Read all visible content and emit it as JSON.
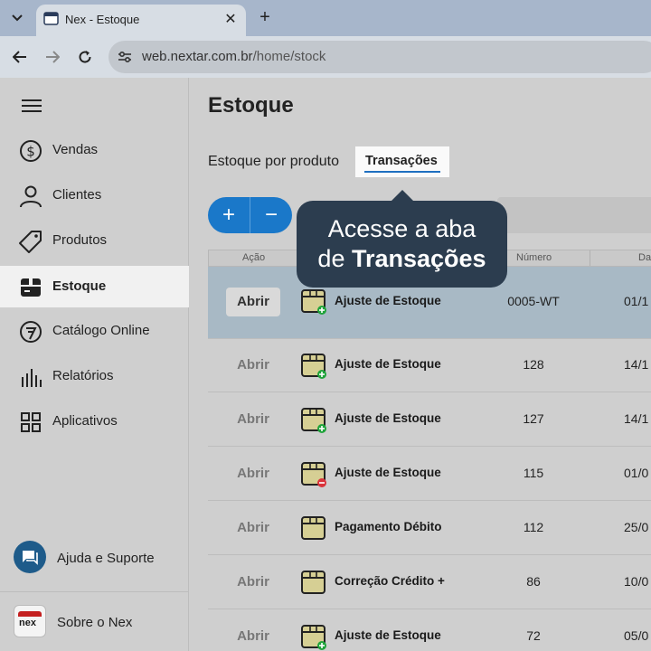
{
  "browser": {
    "tab_title": "Nex - Estoque",
    "url_host": "web.nextar.com.br",
    "url_path": "/home/stock"
  },
  "sidebar": {
    "items": [
      {
        "label": "Vendas",
        "icon": "dollar-circle-icon"
      },
      {
        "label": "Clientes",
        "icon": "user-icon"
      },
      {
        "label": "Produtos",
        "icon": "tag-icon"
      },
      {
        "label": "Estoque",
        "icon": "box-icon",
        "active": true
      },
      {
        "label": "Catálogo Online",
        "icon": "catalog-icon"
      },
      {
        "label": "Relatórios",
        "icon": "bar-chart-icon"
      },
      {
        "label": "Aplicativos",
        "icon": "apps-grid-icon"
      }
    ],
    "help_label": "Ajuda e Suporte",
    "about_label": "Sobre o Nex",
    "logo_text": "nex"
  },
  "main": {
    "title": "Estoque",
    "tabs": [
      {
        "label": "Estoque por produto"
      },
      {
        "label": "Transações",
        "active": true
      }
    ],
    "add_button": "+",
    "remove_button": "−",
    "callout": {
      "line1": "Acesse a aba",
      "line2_prefix": "de ",
      "line2_bold": "Transações"
    },
    "columns": [
      "Ação",
      "Número",
      "Dat"
    ],
    "rows": [
      {
        "action": "Abrir",
        "type": "Ajuste de Estoque",
        "badge": "plus",
        "number": "0005-WT",
        "date": "01/1"
      },
      {
        "action": "Abrir",
        "type": "Ajuste de Estoque",
        "badge": "plus",
        "number": "128",
        "date": "14/1"
      },
      {
        "action": "Abrir",
        "type": "Ajuste de Estoque",
        "badge": "plus",
        "number": "127",
        "date": "14/1"
      },
      {
        "action": "Abrir",
        "type": "Ajuste de Estoque",
        "badge": "minus",
        "number": "115",
        "date": "01/0"
      },
      {
        "action": "Abrir",
        "type": "Pagamento Débito",
        "badge": "none",
        "number": "112",
        "date": "25/0"
      },
      {
        "action": "Abrir",
        "type": "Correção Crédito +",
        "badge": "none",
        "number": "86",
        "date": "10/0"
      },
      {
        "action": "Abrir",
        "type": "Ajuste de Estoque",
        "badge": "plus",
        "number": "72",
        "date": "05/0"
      }
    ]
  },
  "colors": {
    "accent": "#1a78c9",
    "callout_bg": "#2c3d4f",
    "selected_row": "#a8b9c5",
    "badge_plus": "#1fa33a",
    "badge_minus": "#d9323a"
  }
}
